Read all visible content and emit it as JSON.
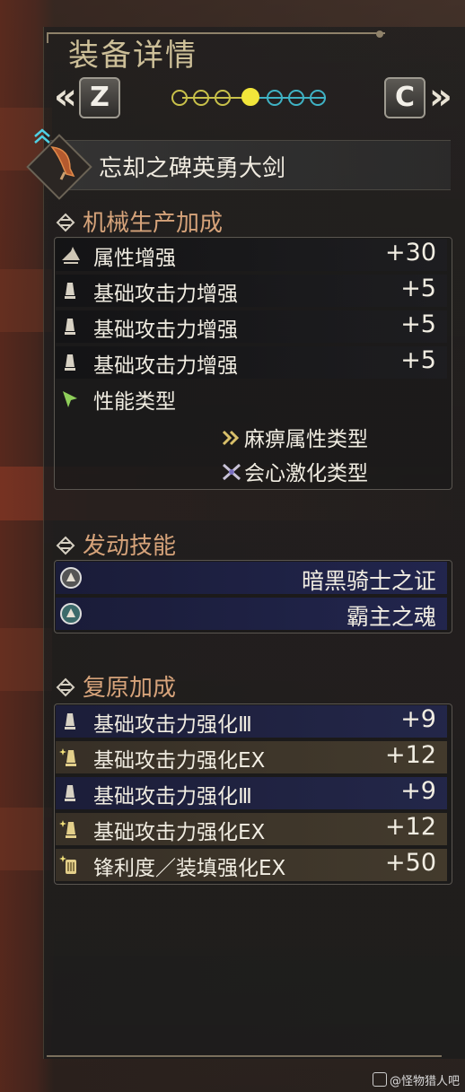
{
  "header": {
    "title": "装备详情",
    "prev_arrow": "«",
    "next_arrow": "»",
    "left_key": "Z",
    "right_key": "C",
    "page_dots": {
      "total": 7,
      "active_index": 3,
      "colors": [
        "#c9c14a",
        "#c9c14a",
        "#c9c14a",
        "#f1e53a",
        "#3fb2c4",
        "#3fb2c4",
        "#3fb2c4"
      ]
    }
  },
  "weapon": {
    "name": "忘却之碑英勇大剑",
    "icon": "great-sword-icon",
    "collapse_icon": "double-chevron-up-icon"
  },
  "sections": {
    "mechanical": {
      "heading": "机械生产加成",
      "rows": [
        {
          "icon": "element-boost-icon",
          "label": "属性增强",
          "value": "+30"
        },
        {
          "icon": "attack-boost-icon",
          "label": "基础攻击力增强",
          "value": "+5"
        },
        {
          "icon": "attack-boost-icon",
          "label": "基础攻击力增强",
          "value": "+5"
        },
        {
          "icon": "attack-boost-icon",
          "label": "基础攻击力增强",
          "value": "+5"
        },
        {
          "icon": "performance-type-icon",
          "label": "性能类型",
          "value": ""
        }
      ],
      "performance_types": [
        {
          "icon": "paralysis-type-icon",
          "label": "麻痹属性类型"
        },
        {
          "icon": "critical-type-icon",
          "label": "会心激化类型"
        }
      ]
    },
    "skills": {
      "heading": "发动技能",
      "items": [
        {
          "icon": "skill-jewel-icon",
          "name": "暗黑骑士之证"
        },
        {
          "icon": "skill-jewel-icon",
          "name": "霸主之魂"
        }
      ]
    },
    "restoration": {
      "heading": "复原加成",
      "rows": [
        {
          "icon": "attack-boost-icon",
          "label": "基础攻击力强化Ⅲ",
          "value": "+9",
          "style": "blue"
        },
        {
          "icon": "attack-boost-ex-icon",
          "label": "基础攻击力强化EX",
          "value": "+12",
          "style": "brown"
        },
        {
          "icon": "attack-boost-icon",
          "label": "基础攻击力强化Ⅲ",
          "value": "+9",
          "style": "blue"
        },
        {
          "icon": "attack-boost-ex-icon",
          "label": "基础攻击力强化EX",
          "value": "+12",
          "style": "brown"
        },
        {
          "icon": "sharpness-ex-icon",
          "label": "锋利度／装填强化EX",
          "value": "+50",
          "style": "brown"
        }
      ]
    }
  },
  "watermark": {
    "text": "@怪物猎人吧"
  }
}
